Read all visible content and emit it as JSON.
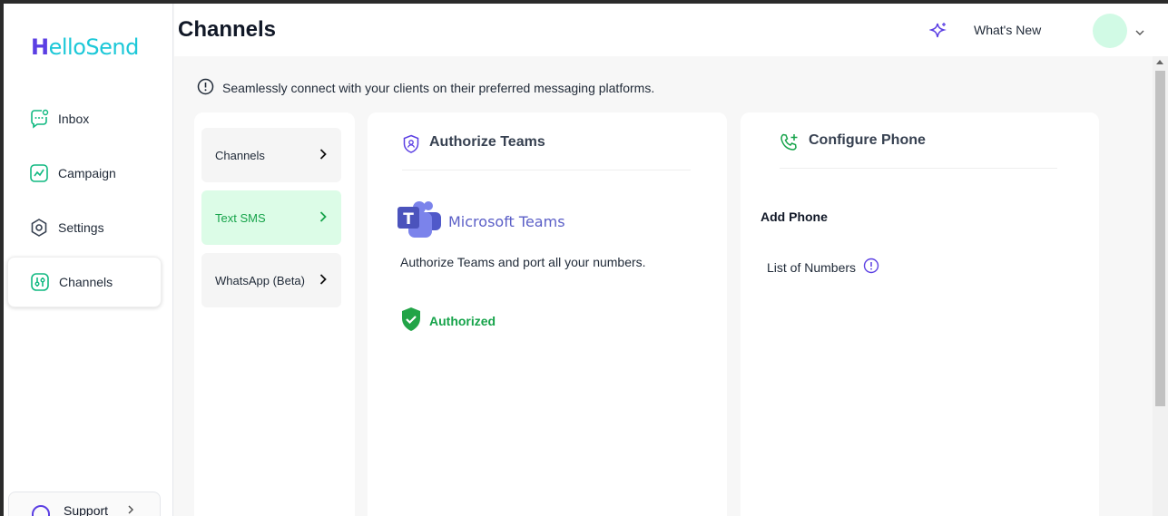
{
  "app": {
    "logo_text": "HelloSend",
    "logo_letter": "H",
    "logo_rest": "elloSend"
  },
  "sidebar": {
    "items": [
      {
        "label": "Inbox",
        "icon": "chat-icon"
      },
      {
        "label": "Campaign",
        "icon": "chart-line-icon"
      },
      {
        "label": "Settings",
        "icon": "gear-icon"
      },
      {
        "label": "Channels",
        "icon": "sliders-icon",
        "active": true
      }
    ],
    "support_label": "Support"
  },
  "header": {
    "title": "Channels",
    "whats_new": "What's New"
  },
  "info": {
    "text": "Seamlessly connect with your clients on their preferred messaging platforms."
  },
  "channels_menu": {
    "items": [
      {
        "label": "Channels"
      },
      {
        "label": "Text SMS",
        "active": true
      },
      {
        "label": "WhatsApp (Beta)"
      }
    ]
  },
  "authorize": {
    "title": "Authorize Teams",
    "brand": "Microsoft Teams",
    "description": "Authorize Teams and port all your numbers.",
    "status": "Authorized"
  },
  "configure": {
    "title": "Configure Phone",
    "add_phone": "Add Phone",
    "list_numbers": "List of Numbers"
  },
  "colors": {
    "accent_green": "#16a34a",
    "accent_purple": "#5b3fe3",
    "logo_cyan": "#1cc8d8",
    "teams_purple": "#5b5fc7"
  }
}
